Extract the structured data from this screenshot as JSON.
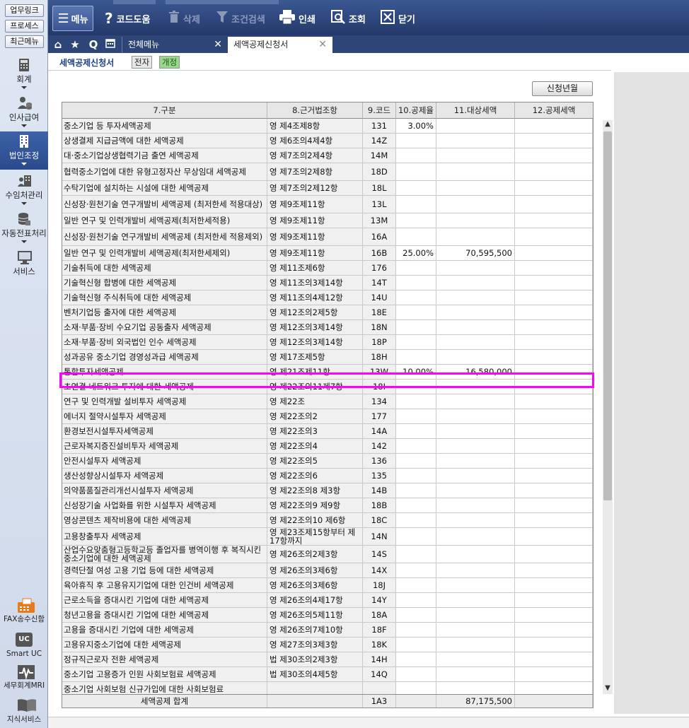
{
  "sidebar": {
    "top_buttons": [
      "업무링크",
      "프로세스",
      "최근메뉴"
    ],
    "items": [
      {
        "label": "회계",
        "icon": "calculator-icon"
      },
      {
        "label": "인사급여",
        "icon": "person-stack-icon"
      },
      {
        "label": "법인조정",
        "icon": "building-icon"
      },
      {
        "label": "수임처관리",
        "icon": "people-building-icon"
      },
      {
        "label": "자동전표처리",
        "icon": "database-icon"
      },
      {
        "label": "서비스",
        "icon": "monitor-icon"
      }
    ],
    "bottom_items": [
      {
        "label": "FAX송수신함",
        "icon": "fax-icon"
      },
      {
        "label": "Smart UC",
        "icon": "uc-icon",
        "badge": "UC"
      },
      {
        "label": "세무회계MRI",
        "icon": "pulse-icon"
      },
      {
        "label": "지식서비스",
        "icon": "book-icon"
      }
    ]
  },
  "toolbar": {
    "menu": "메뉴",
    "code_help": "코드도움",
    "delete": "삭제",
    "search_condition": "조건검색",
    "print": "인쇄",
    "inquiry": "조회",
    "close": "닫기"
  },
  "tabs": {
    "all_menu": "전체메뉴",
    "current": "세액공제신청서"
  },
  "page": {
    "title": "세액공제신청서",
    "badge_electronic": "전자",
    "badge_revised": "개정",
    "apply_month_button": "신청년월"
  },
  "table": {
    "headers": [
      "7.구분",
      "8.근거법조항",
      "9.코드",
      "10.공제율",
      "11.대상세액",
      "12.공제세액"
    ],
    "rows": [
      {
        "cat": "중소기업 등 투자세액공제",
        "law": "영 제4조제8항",
        "code": "131",
        "rate": "3.00%",
        "target": "",
        "tax": ""
      },
      {
        "cat": "상생결제 지급금액에 대한 세액공제",
        "law": "영 제6조의4제4항",
        "code": "14Z",
        "rate": "",
        "target": "",
        "tax": ""
      },
      {
        "cat": "대·중소기업상생협력기금 출연 세액공제",
        "law": "영 제7조의2제4항",
        "code": "14M",
        "rate": "",
        "target": "",
        "tax": ""
      },
      {
        "cat": "협력중소기업에 대한 유형고정자산 무상임대 세액공제",
        "law": "영 제7조의2제8항",
        "code": "18D",
        "rate": "",
        "target": "",
        "tax": ""
      },
      {
        "cat": "수탁기업에 설치하는 시설에 대한 세액공제",
        "law": "영 제7조의2제12항",
        "code": "18L",
        "rate": "",
        "target": "",
        "tax": ""
      },
      {
        "cat": "신성장·원천기술 연구개발비 세액공제 (최저한세 적용대상)",
        "law": "영 제9조제11항",
        "code": "13L",
        "rate": "",
        "target": "",
        "tax": ""
      },
      {
        "cat": "일반 연구 및 인력개발비 세액공제(최저한세적용)",
        "law": "영 제9조제11항",
        "code": "13M",
        "rate": "",
        "target": "",
        "tax": ""
      },
      {
        "cat": "신성장·원천기술 연구개발비 세액공제 (최저한세 적용제외)",
        "law": "영 제9조제11항",
        "code": "16A",
        "rate": "",
        "target": "",
        "tax": ""
      },
      {
        "cat": "일반 연구 및 인력개발비 세액공제(최저한세제외)",
        "law": "영 제9조제11항",
        "code": "16B",
        "rate": "25.00%",
        "target": "70,595,500",
        "tax": ""
      },
      {
        "cat": "기술취득에 대한 세액공제",
        "law": "영 제11조제6항",
        "code": "176",
        "rate": "",
        "target": "",
        "tax": ""
      },
      {
        "cat": "기술혁신형 합병에 대한 세액공제",
        "law": "영 제11조의3제14항",
        "code": "14T",
        "rate": "",
        "target": "",
        "tax": ""
      },
      {
        "cat": "기술혁신형 주식취득에 대한 세액공제",
        "law": "영 제11조의4제12항",
        "code": "14U",
        "rate": "",
        "target": "",
        "tax": ""
      },
      {
        "cat": "벤처기업등 출자에 대한 세액공제",
        "law": "영 제12조의2제5항",
        "code": "18E",
        "rate": "",
        "target": "",
        "tax": ""
      },
      {
        "cat": "소재·부품·장비 수요기업 공동출자 세액공제",
        "law": "영 제12조의3제14항",
        "code": "18N",
        "rate": "",
        "target": "",
        "tax": ""
      },
      {
        "cat": "소재·부품·장비 외국법인 인수 세액공제",
        "law": "영 제12조의3제14항",
        "code": "18P",
        "rate": "",
        "target": "",
        "tax": ""
      },
      {
        "cat": "성과공유 중소기업 경영성과급 세액공제",
        "law": "영 제17조제5항",
        "code": "18H",
        "rate": "",
        "target": "",
        "tax": ""
      },
      {
        "cat": "통합투자세액공제",
        "law": "영 제21조제11항",
        "code": "13W",
        "rate": "10.00%",
        "target": "16,580,000",
        "tax": ""
      },
      {
        "cat": "초연결 네트워크 투자에 대한 세액공제",
        "law": "영 제22조의11제7항",
        "code": "18I",
        "rate": "",
        "target": "",
        "tax": ""
      },
      {
        "cat": "연구 및 인력개발 설비투자 세액공제",
        "law": "영 제22조",
        "code": "134",
        "rate": "",
        "target": "",
        "tax": ""
      },
      {
        "cat": "에너지 절약시설투자 세액공제",
        "law": "영 제22조의2",
        "code": "177",
        "rate": "",
        "target": "",
        "tax": ""
      },
      {
        "cat": "환경보전시설투자세액공제",
        "law": "영 제22조의3",
        "code": "14A",
        "rate": "",
        "target": "",
        "tax": ""
      },
      {
        "cat": "근로자복지증진설비투자 세액공제",
        "law": "영 제22조의4",
        "code": "142",
        "rate": "",
        "target": "",
        "tax": ""
      },
      {
        "cat": "안전시설투자 세액공제",
        "law": "영 제22조의5",
        "code": "136",
        "rate": "",
        "target": "",
        "tax": ""
      },
      {
        "cat": "생산성향상시설투자 세액공제",
        "law": "영 제22조의6",
        "code": "135",
        "rate": "",
        "target": "",
        "tax": ""
      },
      {
        "cat": "의약품품질관리개선시설투자 세액공제",
        "law": "영 제22조의8 제3항",
        "code": "14B",
        "rate": "",
        "target": "",
        "tax": ""
      },
      {
        "cat": "신성장기술 사업화를 위한 시설투자 세액공제",
        "law": "영 제22조의9 제9항",
        "code": "18B",
        "rate": "",
        "target": "",
        "tax": ""
      },
      {
        "cat": "영상콘텐츠 제작비용에 대한 세액공제",
        "law": "영 제22조의10 제6항",
        "code": "18C",
        "rate": "",
        "target": "",
        "tax": ""
      },
      {
        "cat": "고용창출투자 세액공제",
        "law": "영 제23조제15항부터 제17항까지",
        "code": "14N",
        "rate": "",
        "target": "",
        "tax": ""
      },
      {
        "cat": "산업수요맞춤형고등학교등 졸업자를 병역이행 후 복직시킨 중소기업에 대한 세액공제",
        "law": "영 제26조의2제3항",
        "code": "14S",
        "rate": "",
        "target": "",
        "tax": ""
      },
      {
        "cat": "경력단절 여성 고용 기업 등에 대한 세액공제",
        "law": "영 제26조의3제6항",
        "code": "14X",
        "rate": "",
        "target": "",
        "tax": ""
      },
      {
        "cat": "육아휴직 후 고용유지기업에 대한 인건비 세액공제",
        "law": "영 제26조의3제6항",
        "code": "18J",
        "rate": "",
        "target": "",
        "tax": ""
      },
      {
        "cat": "근로소득을 증대시킨 기업에 대한 세액공제",
        "law": "영 제26조의4제17항",
        "code": "14Y",
        "rate": "",
        "target": "",
        "tax": ""
      },
      {
        "cat": "청년고용을 증대시킨 기업에 대한 세액공제",
        "law": "영 제26조의5제11항",
        "code": "18A",
        "rate": "",
        "target": "",
        "tax": ""
      },
      {
        "cat": "고용을 증대시킨 기업에 대한 세액공제",
        "law": "영 제26조의7제10항",
        "code": "18F",
        "rate": "",
        "target": "",
        "tax": ""
      },
      {
        "cat": "고용유지중소기업에 대한 세액공제",
        "law": "영 제27조의3제3항",
        "code": "18K",
        "rate": "",
        "target": "",
        "tax": ""
      },
      {
        "cat": "정규직근로자 전환 세액공제",
        "law": "법 제30조의2제3항",
        "code": "14H",
        "rate": "",
        "target": "",
        "tax": ""
      },
      {
        "cat": "중소기업 고용증가 인원 사회보험료 세액공제",
        "law": "법 제30조의4제5항",
        "code": "14Q",
        "rate": "",
        "target": "",
        "tax": ""
      },
      {
        "cat": "중소기업 사회보험 신규가입에 대한 사회보험료",
        "law": "",
        "code": "",
        "rate": "",
        "target": "",
        "tax": ""
      }
    ],
    "total": {
      "label": "세액공제 합계",
      "code": "1A3",
      "target": "87,175,500",
      "tax": ""
    }
  },
  "colors": {
    "highlight": "#ff00ff",
    "toolbar": "#2e4677",
    "active_side": "#2a4a8c"
  }
}
